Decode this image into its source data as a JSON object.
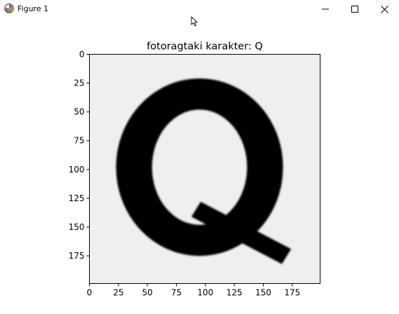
{
  "window": {
    "title": "Figure 1",
    "icons": {
      "app": "matplotlib-logo-icon",
      "minimize": "minimize-icon",
      "maximize": "maximize-icon",
      "close": "close-icon",
      "cursor": "mouse-pointer-icon"
    }
  },
  "chart_data": {
    "type": "image",
    "title": "fotoragtaki karakter: Q",
    "xlabel": "",
    "ylabel": "",
    "xlim": [
      0,
      199
    ],
    "ylim": [
      199,
      0
    ],
    "xticks": [
      0,
      25,
      50,
      75,
      100,
      125,
      150,
      175
    ],
    "yticks": [
      0,
      25,
      50,
      75,
      100,
      125,
      150,
      175
    ],
    "grid": false,
    "image_content": "Q",
    "colors": {
      "foreground": "#000000",
      "background": "#efeff0"
    }
  }
}
